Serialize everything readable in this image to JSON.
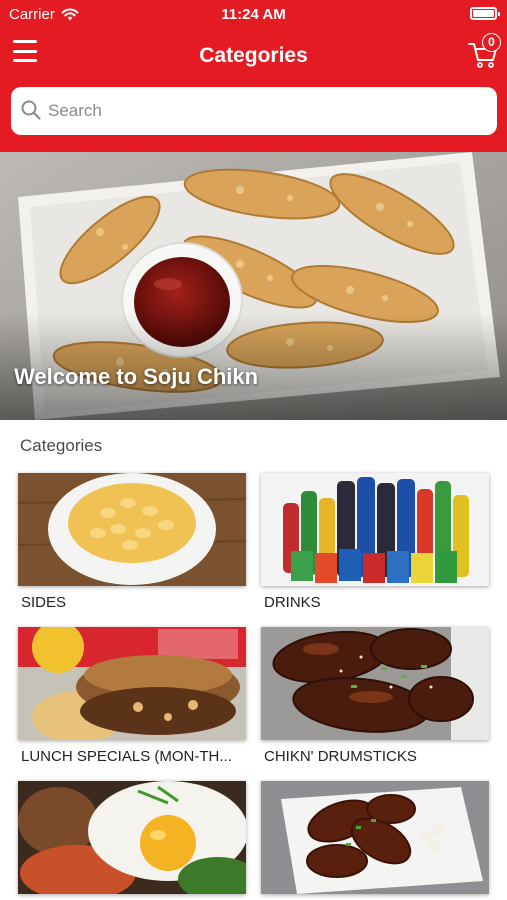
{
  "status": {
    "carrier": "Carrier",
    "time": "11:24 AM"
  },
  "nav": {
    "title": "Categories",
    "cart_count": "0"
  },
  "search": {
    "placeholder": "Search"
  },
  "hero": {
    "caption": "Welcome to Soju Chikn"
  },
  "section": {
    "title": "Categories"
  },
  "categories": [
    {
      "label": "SIDES"
    },
    {
      "label": "DRINKS"
    },
    {
      "label": "LUNCH SPECIALS (MON-TH..."
    },
    {
      "label": "CHIKN' DRUMSTICKS"
    },
    {
      "label": ""
    },
    {
      "label": ""
    }
  ],
  "colors": {
    "brand": "#e41b22",
    "text": "#222222"
  },
  "icons": [
    "wifi-icon",
    "battery-icon",
    "menu-icon",
    "cart-icon",
    "search-icon"
  ]
}
